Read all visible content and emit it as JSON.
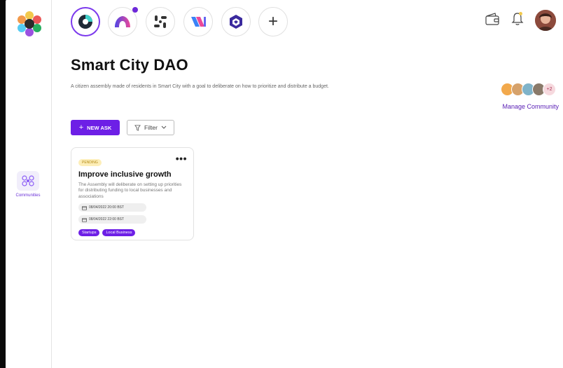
{
  "sidebar": {
    "items": [
      {
        "label": "Communities",
        "icon": "communities-icon"
      }
    ]
  },
  "topbar": {
    "tabs": [
      {
        "name": "community-tab-1",
        "active": true
      },
      {
        "name": "community-tab-2",
        "active": false,
        "notification": true
      },
      {
        "name": "community-tab-3",
        "active": false
      },
      {
        "name": "community-tab-4",
        "active": false
      },
      {
        "name": "community-tab-5",
        "active": false
      }
    ],
    "add_label": "+"
  },
  "page": {
    "title": "Smart City DAO",
    "description": "A citizen assembly made of residents in Smart City with a goal to deliberate on how to prioritize and distribute a budget."
  },
  "members": {
    "extra_count": "+2",
    "manage_label": "Manage Community"
  },
  "actions": {
    "new_ask_label": "NEW ASK",
    "filter_label": "Filter"
  },
  "asks": [
    {
      "status": "PENDING",
      "title": "Improve inclusive growth",
      "description": "The Assembly will deliberate on setting up priorities for distributing funding to local businesses and associations",
      "dates": [
        "08/04/2022 20:00 BST",
        "08/04/2022 22:00 BST"
      ],
      "tags": [
        "Startups",
        "Local Business"
      ]
    }
  ],
  "colors": {
    "accent": "#6d1fe6",
    "pending_bg": "#fdeeb8"
  }
}
